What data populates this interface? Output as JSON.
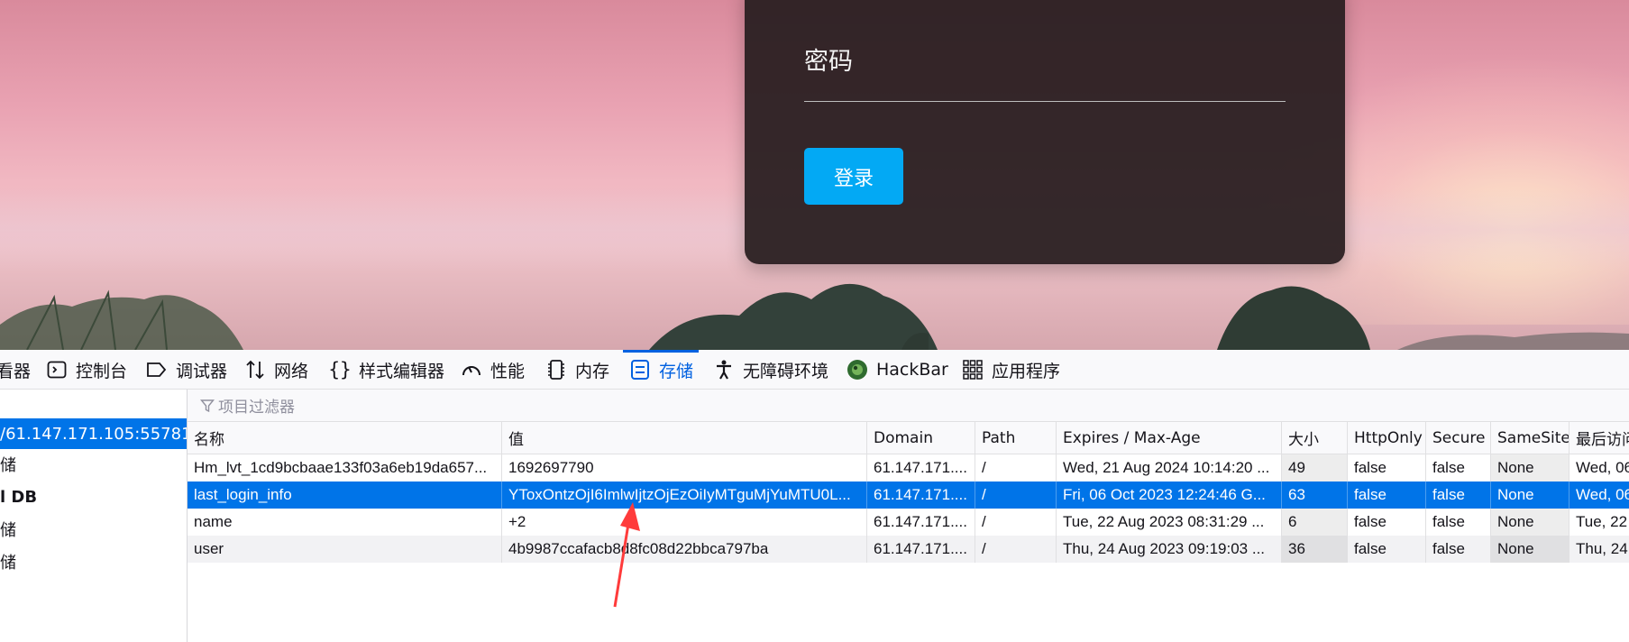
{
  "page": {
    "password_label": "密码",
    "login_button": "登录"
  },
  "devtools": {
    "tabs": [
      {
        "label": "看器",
        "icon": "inspector-icon"
      },
      {
        "label": "控制台",
        "icon": "console-icon"
      },
      {
        "label": "调试器",
        "icon": "debugger-icon"
      },
      {
        "label": "网络",
        "icon": "network-arrows-icon"
      },
      {
        "label": "样式编辑器",
        "icon": "braces-icon"
      },
      {
        "label": "性能",
        "icon": "gauge-icon"
      },
      {
        "label": "内存",
        "icon": "memory-chip-icon"
      },
      {
        "label": "存储",
        "icon": "storage-icon"
      },
      {
        "label": "无障碍环境",
        "icon": "accessibility-icon"
      },
      {
        "label": "HackBar",
        "icon": "hackbar-icon"
      },
      {
        "label": "应用程序",
        "icon": "app-grid-icon"
      }
    ],
    "active_tab": "存储",
    "filter_placeholder": "项目过滤器",
    "sidebar": [
      {
        "label": "/61.147.171.105:55781",
        "selected": true
      },
      {
        "label": "储"
      },
      {
        "label": "l DB"
      },
      {
        "label": "储"
      },
      {
        "label": "储"
      }
    ],
    "table": {
      "columns": [
        "名称",
        "值",
        "Domain",
        "Path",
        "Expires / Max-Age",
        "大小",
        "HttpOnly",
        "Secure",
        "SameSite",
        "最后访问"
      ],
      "rows": [
        {
          "name": "Hm_lvt_1cd9bcbaae133f03a6eb19da657...",
          "value": "1692697790",
          "domain": "61.147.171....",
          "path": "/",
          "expires": "Wed, 21 Aug 2024 10:14:20 ...",
          "size": "49",
          "httponly": "false",
          "secure": "false",
          "samesite": "None",
          "last": "Wed, 06"
        },
        {
          "name": "last_login_info",
          "value": "YToxOntzOjI6ImlwIjtzOjEzOiIyMTguMjYuMTU0L...",
          "domain": "61.147.171....",
          "path": "/",
          "expires": "Fri, 06 Oct 2023 12:24:46 G...",
          "size": "63",
          "httponly": "false",
          "secure": "false",
          "samesite": "None",
          "last": "Wed, 06"
        },
        {
          "name": "name",
          "value": "+2",
          "domain": "61.147.171....",
          "path": "/",
          "expires": "Tue, 22 Aug 2023 08:31:29 ...",
          "size": "6",
          "httponly": "false",
          "secure": "false",
          "samesite": "None",
          "last": "Tue, 22"
        },
        {
          "name": "user",
          "value": "4b9987ccafacb8d8fc08d22bbca797ba",
          "domain": "61.147.171....",
          "path": "/",
          "expires": "Thu, 24 Aug 2023 09:19:03 ...",
          "size": "36",
          "httponly": "false",
          "secure": "false",
          "samesite": "None",
          "last": "Thu, 24"
        }
      ],
      "selected_row": 1
    }
  },
  "colors": {
    "accent": "#0061e0",
    "selection": "#0074e8",
    "login_button": "#03a9f4",
    "annotation_arrow": "#ff3b3b"
  }
}
